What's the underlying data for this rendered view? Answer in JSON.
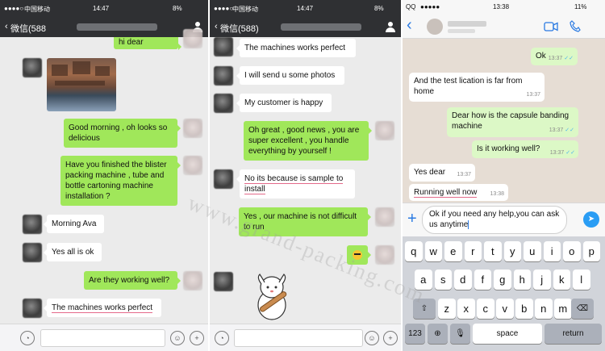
{
  "wechat_status": {
    "carrier": "中国移动",
    "time": "14:47",
    "battery": "8%"
  },
  "wechat_nav_1": {
    "back": "‹",
    "title": "微信(588"
  },
  "wechat_nav_2": {
    "back": "‹",
    "title": "微信(588)"
  },
  "chat1": {
    "top_bubble": "hi dear",
    "m1": "Good morning , oh looks so delicious",
    "m2": "Have you finished the blister packing machine , tube and bottle cartoning machine installation ?",
    "m3": "Morning Ava",
    "m4": "Yes all is ok",
    "m5": "Are they working well?",
    "m6": "The machines works perfect"
  },
  "chat2": {
    "m1": "The machines works perfect",
    "m2": "I will send u some photos",
    "m3": "My customer is happy",
    "m4": "Oh great , good news , you are super excellent , you handle everything by yourself !",
    "m5": "No its because is sample to install",
    "m6": "Yes , our machine is not difficult to run",
    "m7_emoji": "sunglasses-emoji"
  },
  "watermark": "www.grand-packing.com",
  "whatsapp_status": {
    "carrier": "QQ",
    "time": "13:38",
    "battery": "11%"
  },
  "whatsapp_chat": {
    "m1": {
      "text": "Ok",
      "time": "13:37"
    },
    "m2": {
      "text": "And the test lication is far from home",
      "time": "13:37"
    },
    "m3": {
      "text": "Dear how is the capsule banding machine",
      "time": "13:37"
    },
    "m4": {
      "text": "Is it working well?",
      "time": "13:37"
    },
    "m5": {
      "text": "Yes dear",
      "time": "13:37"
    },
    "m6": {
      "text": "Running well now",
      "time": "13:38"
    }
  },
  "whatsapp_compose": {
    "value": "Ok if you need any help,you can ask us anytime"
  },
  "keyboard": {
    "row1": [
      "q",
      "w",
      "e",
      "r",
      "t",
      "y",
      "u",
      "i",
      "o",
      "p"
    ],
    "row2": [
      "a",
      "s",
      "d",
      "f",
      "g",
      "h",
      "j",
      "k",
      "l"
    ],
    "row3": [
      "z",
      "x",
      "c",
      "v",
      "b",
      "n",
      "m"
    ],
    "num_key": "123",
    "space_key": "space",
    "return_key": "return"
  },
  "colors": {
    "wechat_green": "#a0e75a",
    "wechat_bar": "#2f3033",
    "whatsapp_green": "#dcf8c6",
    "whatsapp_bg": "#e6ddd4",
    "read_tick": "#4fb6ec"
  }
}
